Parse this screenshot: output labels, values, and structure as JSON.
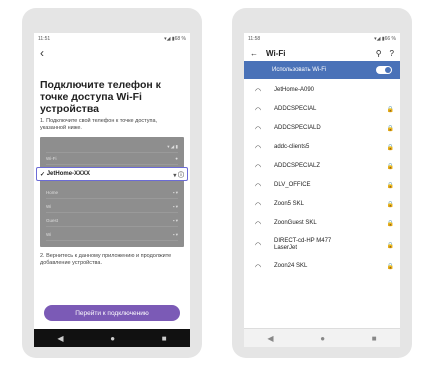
{
  "left_phone": {
    "status_time": "11:51",
    "status_right": "▾◢ ▮68 %",
    "back_icon": "back-arrow-icon",
    "title": "Подключите телефон к точке доступа Wi-Fi устройства",
    "step1": "1. Подключите свой телефон к точке доступа, указанной ниже.",
    "highlight_network": "JetHome-XXXX",
    "illus_rows": [
      "Home",
      "Wi",
      "Guest",
      "Wi"
    ],
    "step2": "2. Вернитесь к данному приложению и продолжите добавление устройства.",
    "cta_label": "Перейти к подключению",
    "accent_color": "#7b5ab6"
  },
  "right_phone": {
    "status_time": "11:58",
    "status_right": "▾◢ ▮66 %",
    "appbar_title": "Wi-Fi",
    "toggle_label": "Использовать Wi-Fi",
    "toggle_on": true,
    "networks": [
      {
        "name": "JetHome-A090",
        "locked": false
      },
      {
        "name": "ADDCSPECIAL",
        "locked": true
      },
      {
        "name": "ADDCSPECIALD",
        "locked": true
      },
      {
        "name": "addc-clients5",
        "locked": true
      },
      {
        "name": "ADDCSPECIALZ",
        "locked": true
      },
      {
        "name": "DLV_OFFICE",
        "locked": true
      },
      {
        "name": "Zoon5 SKL",
        "locked": true
      },
      {
        "name": "ZoonGuest SKL",
        "locked": true
      },
      {
        "name": "DIRECT-cd-HP M477 LaserJet",
        "locked": true
      },
      {
        "name": "Zoon24 SKL",
        "locked": true
      }
    ],
    "accent_color": "#4a72b8"
  }
}
